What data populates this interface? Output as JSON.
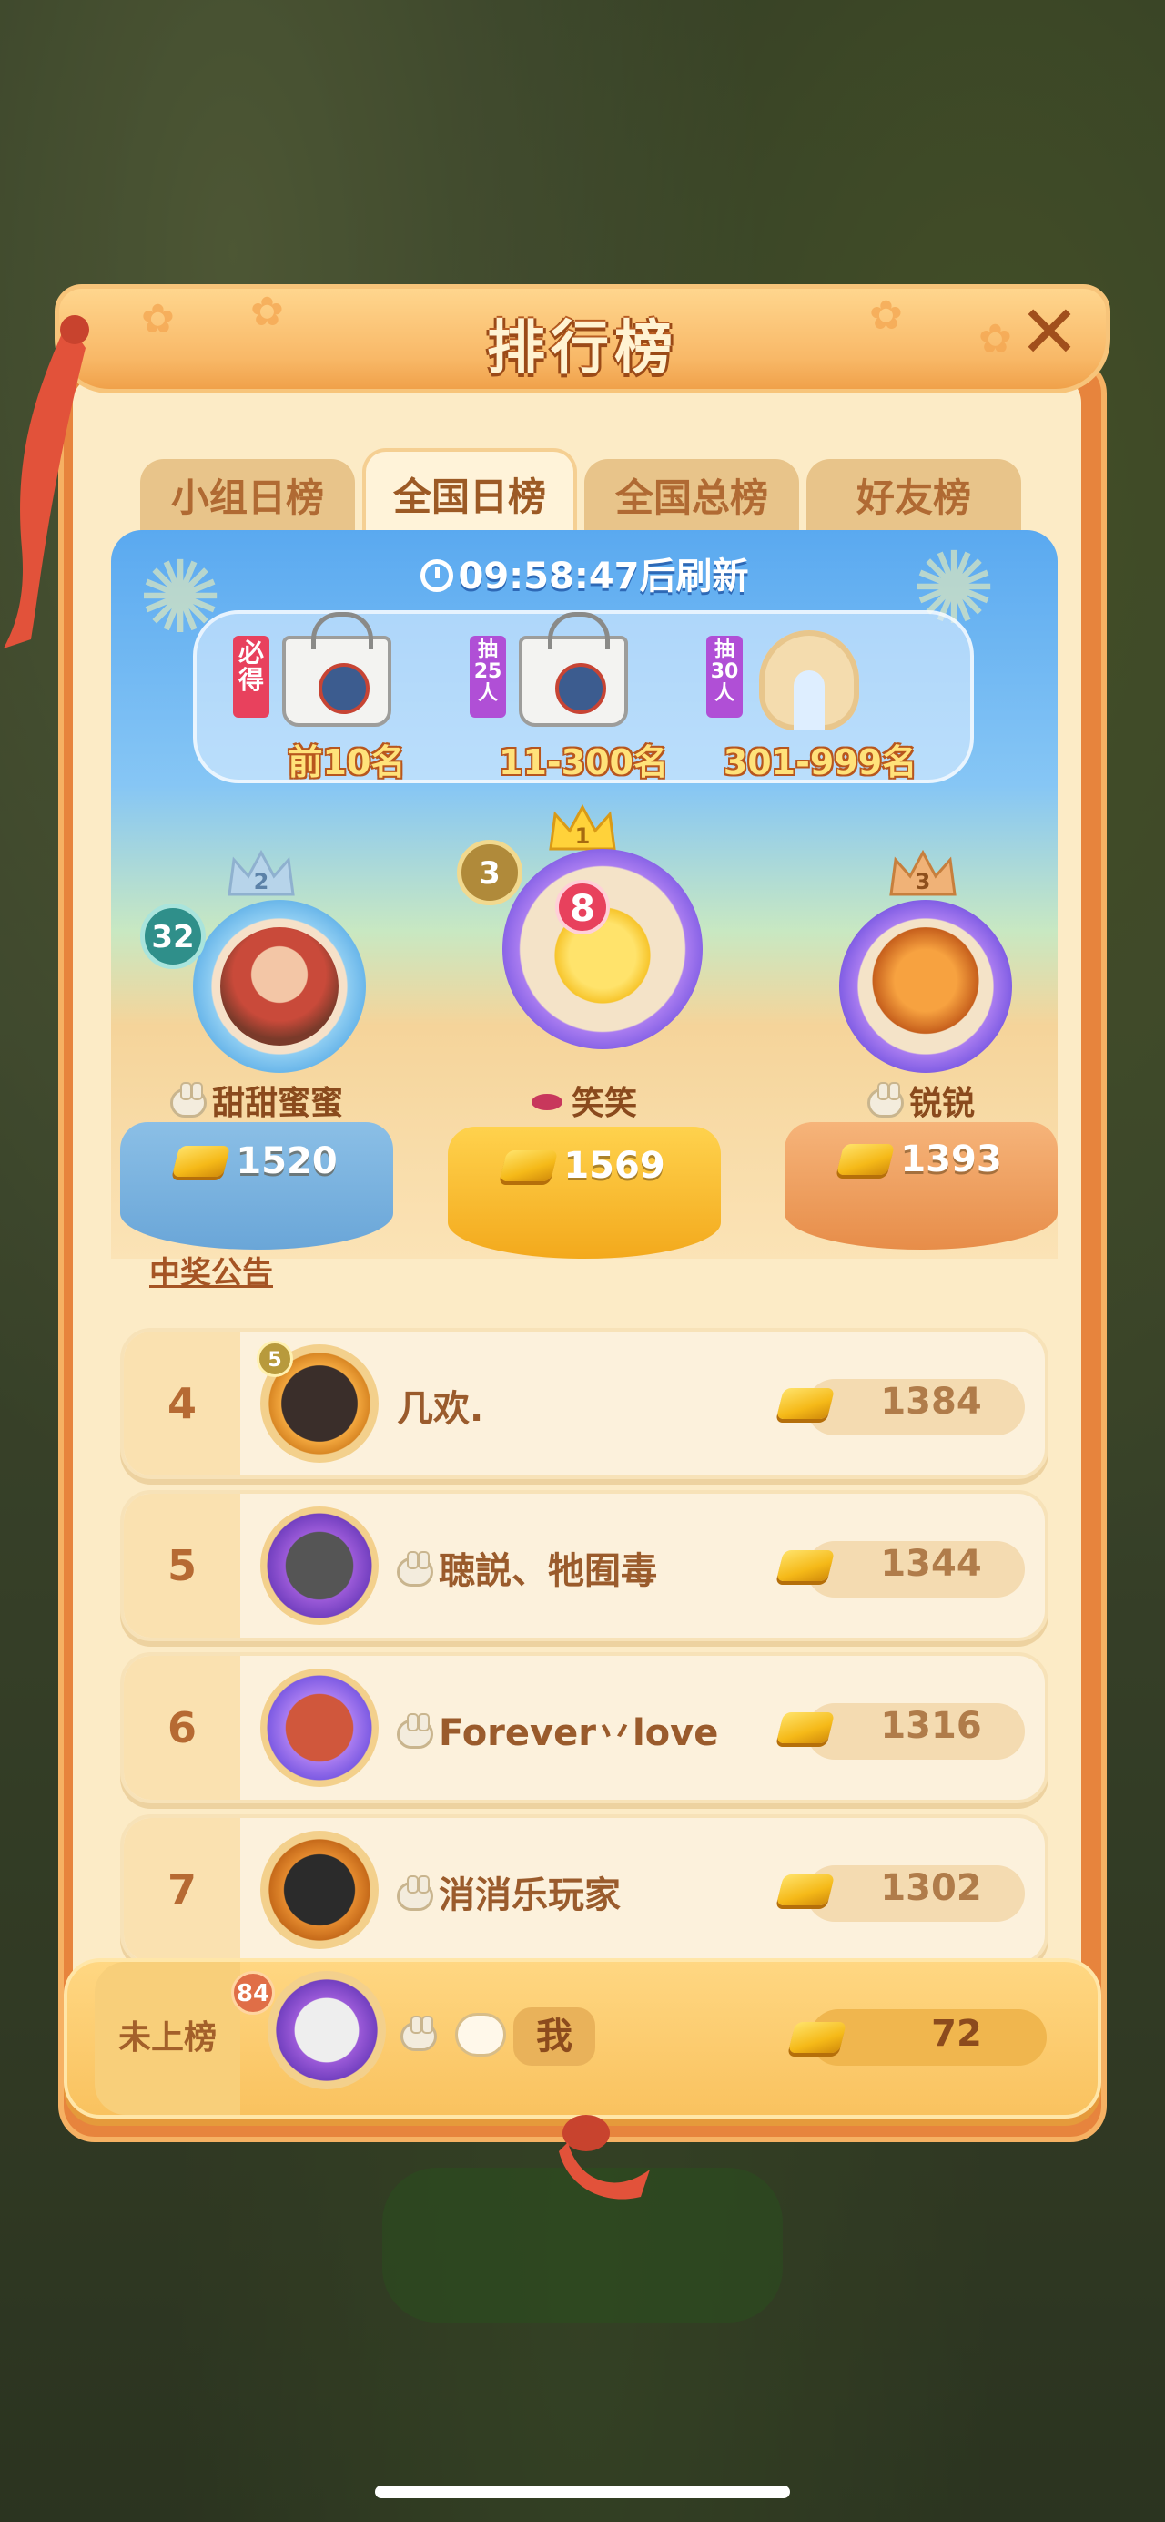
{
  "title": "排行榜",
  "tabs": [
    {
      "label": "小组日榜"
    },
    {
      "label": "全国日榜"
    },
    {
      "label": "全国总榜"
    },
    {
      "label": "好友榜"
    }
  ],
  "refresh_text": "09:58:47后刷新",
  "prizes": [
    {
      "tag": "必得",
      "label": "前10名",
      "icon": "tote-bag-icon"
    },
    {
      "tag": "抽25人",
      "label": "11-300名",
      "icon": "tote-bag-icon"
    },
    {
      "tag": "抽30人",
      "label": "301-999名",
      "icon": "neck-pillow-icon"
    }
  ],
  "podium": {
    "first": {
      "rank": "1",
      "level": "3",
      "badge": "8",
      "name": "笑笑",
      "score": "1569"
    },
    "second": {
      "rank": "2",
      "level": "32",
      "name": "甜甜蜜蜜",
      "score": "1520"
    },
    "third": {
      "rank": "3",
      "name": "锐锐",
      "score": "1393"
    }
  },
  "announcement": "中奖公告",
  "rows": [
    {
      "rank": "4",
      "name": "几欢.",
      "score": "1384",
      "level": "5"
    },
    {
      "rank": "5",
      "name": "聴説、牠囿毒",
      "score": "1344"
    },
    {
      "rank": "6",
      "name": "Forever丷love",
      "score": "1316"
    },
    {
      "rank": "7",
      "name": "消消乐玩家",
      "score": "1302"
    }
  ],
  "me": {
    "rank_label": "未上榜",
    "level": "84",
    "name": "我",
    "score": "72"
  },
  "colors": {
    "accent": "#e7843d",
    "panel": "#fcebc6",
    "gold": "#f5b918"
  }
}
